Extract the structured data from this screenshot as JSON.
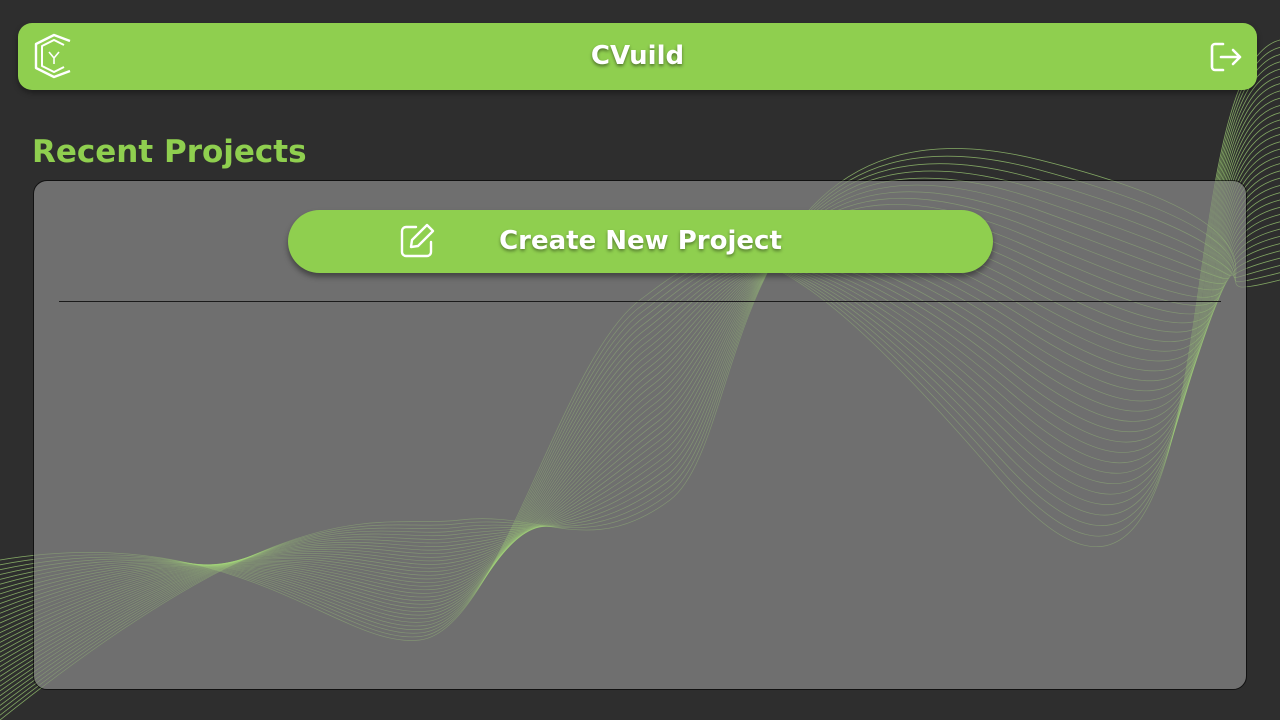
{
  "app": {
    "title": "CVuild",
    "accent_color": "#8fcf4f",
    "background_color": "#2e2e2e",
    "panel_color": "#6f6f6f"
  },
  "header": {
    "logo_icon": "cvuild-logo-icon",
    "logout_icon": "logout-icon"
  },
  "main": {
    "section_title": "Recent Projects",
    "create_button": {
      "label": "Create New Project",
      "icon": "edit-icon"
    }
  }
}
